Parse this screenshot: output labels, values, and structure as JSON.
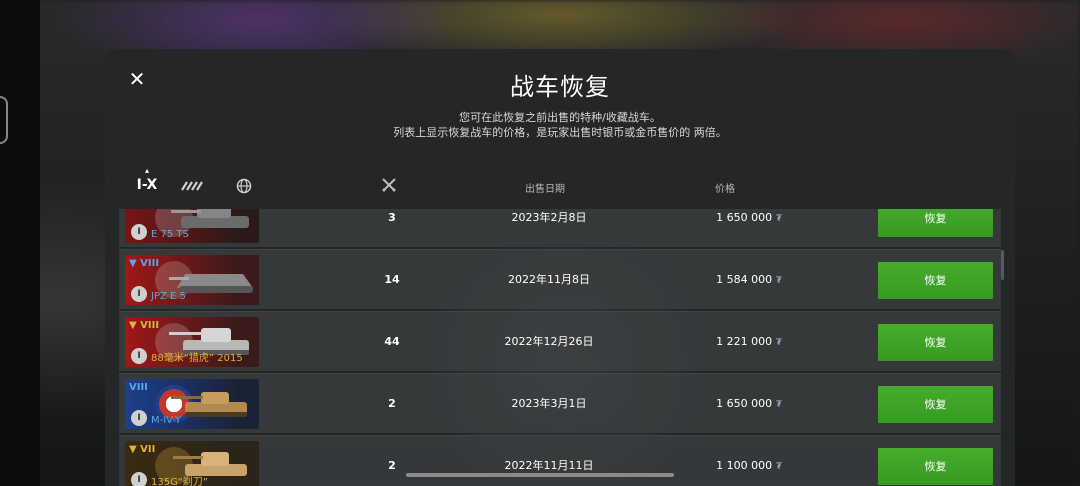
{
  "dialog": {
    "title": "战车恢复",
    "description_line1": "您可在此恢复之前出售的特种/收藏战车。",
    "description_line2": "列表上显示恢复战车的价格，是玩家出售时银币或金币售价的 两倍。"
  },
  "filters": {
    "tier_label": "I-X",
    "tier_caret": "▴",
    "type_icon": "vehicle-type-icon",
    "nation_icon": "globe-icon"
  },
  "columns": {
    "battles_icon": "crossed-swords-icon",
    "sale_date": "出售日期",
    "price": "价格"
  },
  "rows": [
    {
      "tier": "",
      "name": "E 75 TS",
      "battles": "3",
      "date": "2023年2月8日",
      "price": "1 650 000",
      "restore": "恢复",
      "flag_color": "#8c1a1a",
      "name_color": "#5aa6e6"
    },
    {
      "tier": "▼ VIII",
      "name": "JPZ E 5",
      "battles": "14",
      "date": "2022年11月8日",
      "price": "1 584 000",
      "restore": "恢复",
      "flag_color": "#a01818",
      "name_color": "#5aa6e6"
    },
    {
      "tier": "▼ VIII",
      "name": "88毫米“猎虎” 2015",
      "battles": "44",
      "date": "2022年12月26日",
      "price": "1 221 000",
      "restore": "恢复",
      "flag_color": "#a01818",
      "name_color": "#e0b43a"
    },
    {
      "tier": "VIII",
      "name": "M-IV-Y",
      "battles": "2",
      "date": "2023年3月1日",
      "price": "1 650 000",
      "restore": "恢复",
      "flag_color": "#1d3f8c",
      "name_color": "#5aa6e6"
    },
    {
      "tier": "▼ VII",
      "name": "135G“剃刀”",
      "battles": "2",
      "date": "2022年11月11日",
      "price": "1 100 000",
      "restore": "恢复",
      "flag_color": "#3a2a10",
      "name_color": "#e0b43a"
    }
  ],
  "currency_icon": "silver-coin-icon",
  "close_icon": "close-icon"
}
